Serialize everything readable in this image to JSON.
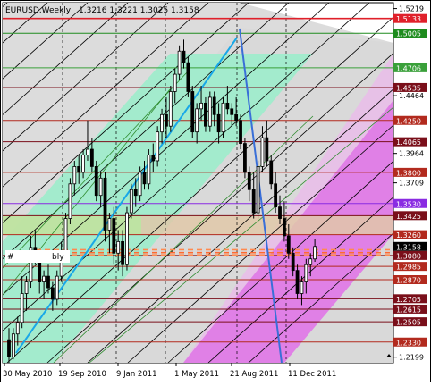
{
  "header": {
    "symbol_period": "EURUSD,Weekly",
    "ohlc": "1.3216 1.3221 1.3025 1.3158"
  },
  "chart_data": {
    "type": "candlestick",
    "symbol": "EURUSD",
    "timeframe": "Weekly",
    "open": 1.3216,
    "high": 1.3221,
    "low": 1.3025,
    "close": 1.3158,
    "ylim": [
      1.215,
      1.527
    ],
    "x_labels": [
      "30 May 2010",
      "19 Sep 2010",
      "9 Jan 2011",
      "1 May 2011",
      "21 Aug 2011",
      "11 Dec 2011"
    ],
    "y_ticks": [
      1.5219,
      1.4464,
      1.3964,
      1.3709,
      1.2199
    ],
    "levels": [
      {
        "value": 1.5133,
        "label": "1.5133",
        "color": "#e0202a"
      },
      {
        "value": 1.5005,
        "label": "1.5005",
        "color": "#1e8c1e"
      },
      {
        "value": 1.4706,
        "label": "1.4706",
        "color": "#3aa03a"
      },
      {
        "value": 1.4535,
        "label": "1.4535",
        "color": "#7a0f1a"
      },
      {
        "value": 1.425,
        "label": "1.4250",
        "color": "#b22a1e"
      },
      {
        "value": 1.4065,
        "label": "1.4065",
        "color": "#7a0f1a"
      },
      {
        "value": 1.38,
        "label": "1.3800",
        "color": "#b22a1e"
      },
      {
        "value": 1.353,
        "label": "1.3530",
        "color": "#8a2be2"
      },
      {
        "value": 1.3425,
        "label": "1.3425",
        "color": "#7a0f1a"
      },
      {
        "value": 1.326,
        "label": "1.3260",
        "color": "#b22a1e"
      },
      {
        "value": 1.3158,
        "label": "1.3158",
        "color": "#000000"
      },
      {
        "value": 1.308,
        "label": "1.3080",
        "color": "#7a0f1a"
      },
      {
        "value": 1.2985,
        "label": "1.2985",
        "color": "#b22a1e"
      },
      {
        "value": 1.287,
        "label": "1.2870",
        "color": "#b22a1e"
      },
      {
        "value": 1.2705,
        "label": "1.2705",
        "color": "#7a0f1a"
      },
      {
        "value": 1.2615,
        "label": "1.2615",
        "color": "#7a0f1a"
      },
      {
        "value": 1.2505,
        "label": "1.2505",
        "color": "#7a0f1a"
      },
      {
        "value": 1.233,
        "label": "1.2330",
        "color": "#b22a1e"
      }
    ],
    "marker_text": "#",
    "marker_label": "bly",
    "candles": [
      [
        1.235,
        1.245,
        1.215,
        1.22
      ],
      [
        1.22,
        1.245,
        1.218,
        1.24
      ],
      [
        1.24,
        1.255,
        1.23,
        1.25
      ],
      [
        1.25,
        1.29,
        1.245,
        1.275
      ],
      [
        1.275,
        1.29,
        1.26,
        1.285
      ],
      [
        1.285,
        1.325,
        1.28,
        1.315
      ],
      [
        1.315,
        1.33,
        1.3,
        1.305
      ],
      [
        1.305,
        1.31,
        1.275,
        1.285
      ],
      [
        1.285,
        1.295,
        1.27,
        1.29
      ],
      [
        1.29,
        1.3,
        1.275,
        1.28
      ],
      [
        1.28,
        1.285,
        1.26,
        1.27
      ],
      [
        1.27,
        1.295,
        1.265,
        1.29
      ],
      [
        1.29,
        1.32,
        1.285,
        1.31
      ],
      [
        1.31,
        1.345,
        1.305,
        1.34
      ],
      [
        1.34,
        1.375,
        1.335,
        1.37
      ],
      [
        1.37,
        1.39,
        1.36,
        1.385
      ],
      [
        1.385,
        1.395,
        1.37,
        1.38
      ],
      [
        1.38,
        1.4,
        1.375,
        1.395
      ],
      [
        1.395,
        1.425,
        1.39,
        1.4
      ],
      [
        1.4,
        1.41,
        1.38,
        1.385
      ],
      [
        1.385,
        1.39,
        1.355,
        1.36
      ],
      [
        1.36,
        1.38,
        1.35,
        1.375
      ],
      [
        1.375,
        1.38,
        1.32,
        1.33
      ],
      [
        1.33,
        1.345,
        1.31,
        1.34
      ],
      [
        1.34,
        1.35,
        1.3,
        1.31
      ],
      [
        1.31,
        1.33,
        1.295,
        1.32
      ],
      [
        1.32,
        1.33,
        1.29,
        1.3
      ],
      [
        1.3,
        1.35,
        1.295,
        1.345
      ],
      [
        1.345,
        1.37,
        1.34,
        1.365
      ],
      [
        1.365,
        1.375,
        1.35,
        1.36
      ],
      [
        1.36,
        1.385,
        1.355,
        1.38
      ],
      [
        1.38,
        1.39,
        1.365,
        1.37
      ],
      [
        1.37,
        1.4,
        1.365,
        1.395
      ],
      [
        1.395,
        1.405,
        1.38,
        1.39
      ],
      [
        1.39,
        1.42,
        1.385,
        1.415
      ],
      [
        1.415,
        1.435,
        1.405,
        1.43
      ],
      [
        1.43,
        1.445,
        1.41,
        1.42
      ],
      [
        1.42,
        1.455,
        1.415,
        1.45
      ],
      [
        1.45,
        1.47,
        1.44,
        1.465
      ],
      [
        1.465,
        1.49,
        1.46,
        1.485
      ],
      [
        1.485,
        1.495,
        1.47,
        1.475
      ],
      [
        1.475,
        1.48,
        1.445,
        1.45
      ],
      [
        1.45,
        1.455,
        1.41,
        1.415
      ],
      [
        1.415,
        1.44,
        1.405,
        1.435
      ],
      [
        1.435,
        1.455,
        1.425,
        1.44
      ],
      [
        1.44,
        1.445,
        1.415,
        1.42
      ],
      [
        1.42,
        1.45,
        1.415,
        1.445
      ],
      [
        1.445,
        1.45,
        1.42,
        1.43
      ],
      [
        1.43,
        1.44,
        1.405,
        1.415
      ],
      [
        1.415,
        1.445,
        1.41,
        1.44
      ],
      [
        1.44,
        1.455,
        1.43,
        1.435
      ],
      [
        1.435,
        1.44,
        1.42,
        1.43
      ],
      [
        1.43,
        1.445,
        1.42,
        1.425
      ],
      [
        1.425,
        1.43,
        1.4,
        1.405
      ],
      [
        1.405,
        1.41,
        1.375,
        1.38
      ],
      [
        1.38,
        1.385,
        1.355,
        1.365
      ],
      [
        1.365,
        1.38,
        1.34,
        1.345
      ],
      [
        1.345,
        1.39,
        1.34,
        1.385
      ],
      [
        1.385,
        1.42,
        1.38,
        1.41
      ],
      [
        1.41,
        1.425,
        1.385,
        1.39
      ],
      [
        1.39,
        1.395,
        1.365,
        1.37
      ],
      [
        1.37,
        1.38,
        1.345,
        1.35
      ],
      [
        1.35,
        1.36,
        1.335,
        1.34
      ],
      [
        1.34,
        1.355,
        1.32,
        1.325
      ],
      [
        1.325,
        1.335,
        1.305,
        1.31
      ],
      [
        1.31,
        1.315,
        1.29,
        1.295
      ],
      [
        1.295,
        1.3,
        1.27,
        1.275
      ],
      [
        1.275,
        1.29,
        1.265,
        1.285
      ],
      [
        1.285,
        1.305,
        1.275,
        1.3
      ],
      [
        1.3,
        1.31,
        1.29,
        1.305
      ],
      [
        1.305,
        1.3221,
        1.3025,
        1.3158
      ]
    ]
  }
}
